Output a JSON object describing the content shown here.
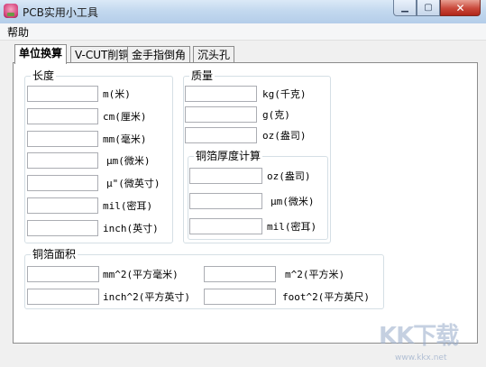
{
  "window": {
    "title": "PCB实用小工具"
  },
  "menu": {
    "items": [
      "帮助"
    ]
  },
  "tabs": [
    "单位换算",
    "V-CUT削铜",
    "金手指倒角",
    "沉头孔"
  ],
  "length": {
    "title": "长度",
    "fields": [
      {
        "unit": "m(米)",
        "value": ""
      },
      {
        "unit": "cm(厘米)",
        "value": ""
      },
      {
        "unit": "mm(毫米)",
        "value": ""
      },
      {
        "unit": "μm(微米)",
        "value": ""
      },
      {
        "unit": "μ\"(微英寸)",
        "value": ""
      },
      {
        "unit": "mil(密耳)",
        "value": ""
      },
      {
        "unit": "inch(英寸)",
        "value": ""
      }
    ]
  },
  "mass": {
    "title": "质量",
    "fields": [
      {
        "unit": "kg(千克)",
        "value": ""
      },
      {
        "unit": "g(克)",
        "value": ""
      },
      {
        "unit": "oz(盎司)",
        "value": ""
      }
    ]
  },
  "foil_thickness": {
    "title": "铜箔厚度计算",
    "fields": [
      {
        "unit": "oz(盎司)",
        "value": ""
      },
      {
        "unit": "μm(微米)",
        "value": ""
      },
      {
        "unit": "mil(密耳)",
        "value": ""
      }
    ]
  },
  "foil_area": {
    "title": "铜箔面积",
    "fields": [
      {
        "unit": "mm^2(平方毫米)",
        "value": ""
      },
      {
        "unit": "m^2(平方米)",
        "value": ""
      },
      {
        "unit": "inch^2(平方英寸)",
        "value": ""
      },
      {
        "unit": "foot^2(平方英尺)",
        "value": ""
      }
    ]
  },
  "watermark": {
    "brand": "KK下载",
    "url": "www.kkx.net"
  }
}
